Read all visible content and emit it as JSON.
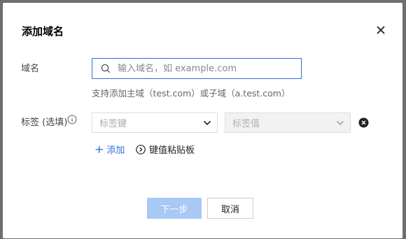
{
  "dialog": {
    "title": "添加域名",
    "close_icon": "close-icon"
  },
  "domain_field": {
    "label": "域名",
    "placeholder": "输入域名，如 example.com",
    "value": "",
    "hint": "支持添加主域（test.com）或子域（a.test.com）"
  },
  "tags": {
    "label": "标签 (选填)",
    "key_placeholder": "标签键",
    "value_placeholder": "标签值",
    "add_label": "添加",
    "paste_label": "键值粘贴板"
  },
  "footer": {
    "next_label": "下一步",
    "cancel_label": "取消"
  },
  "colors": {
    "accent": "#2d6fd9",
    "primary_disabled": "#a8c8f5"
  }
}
